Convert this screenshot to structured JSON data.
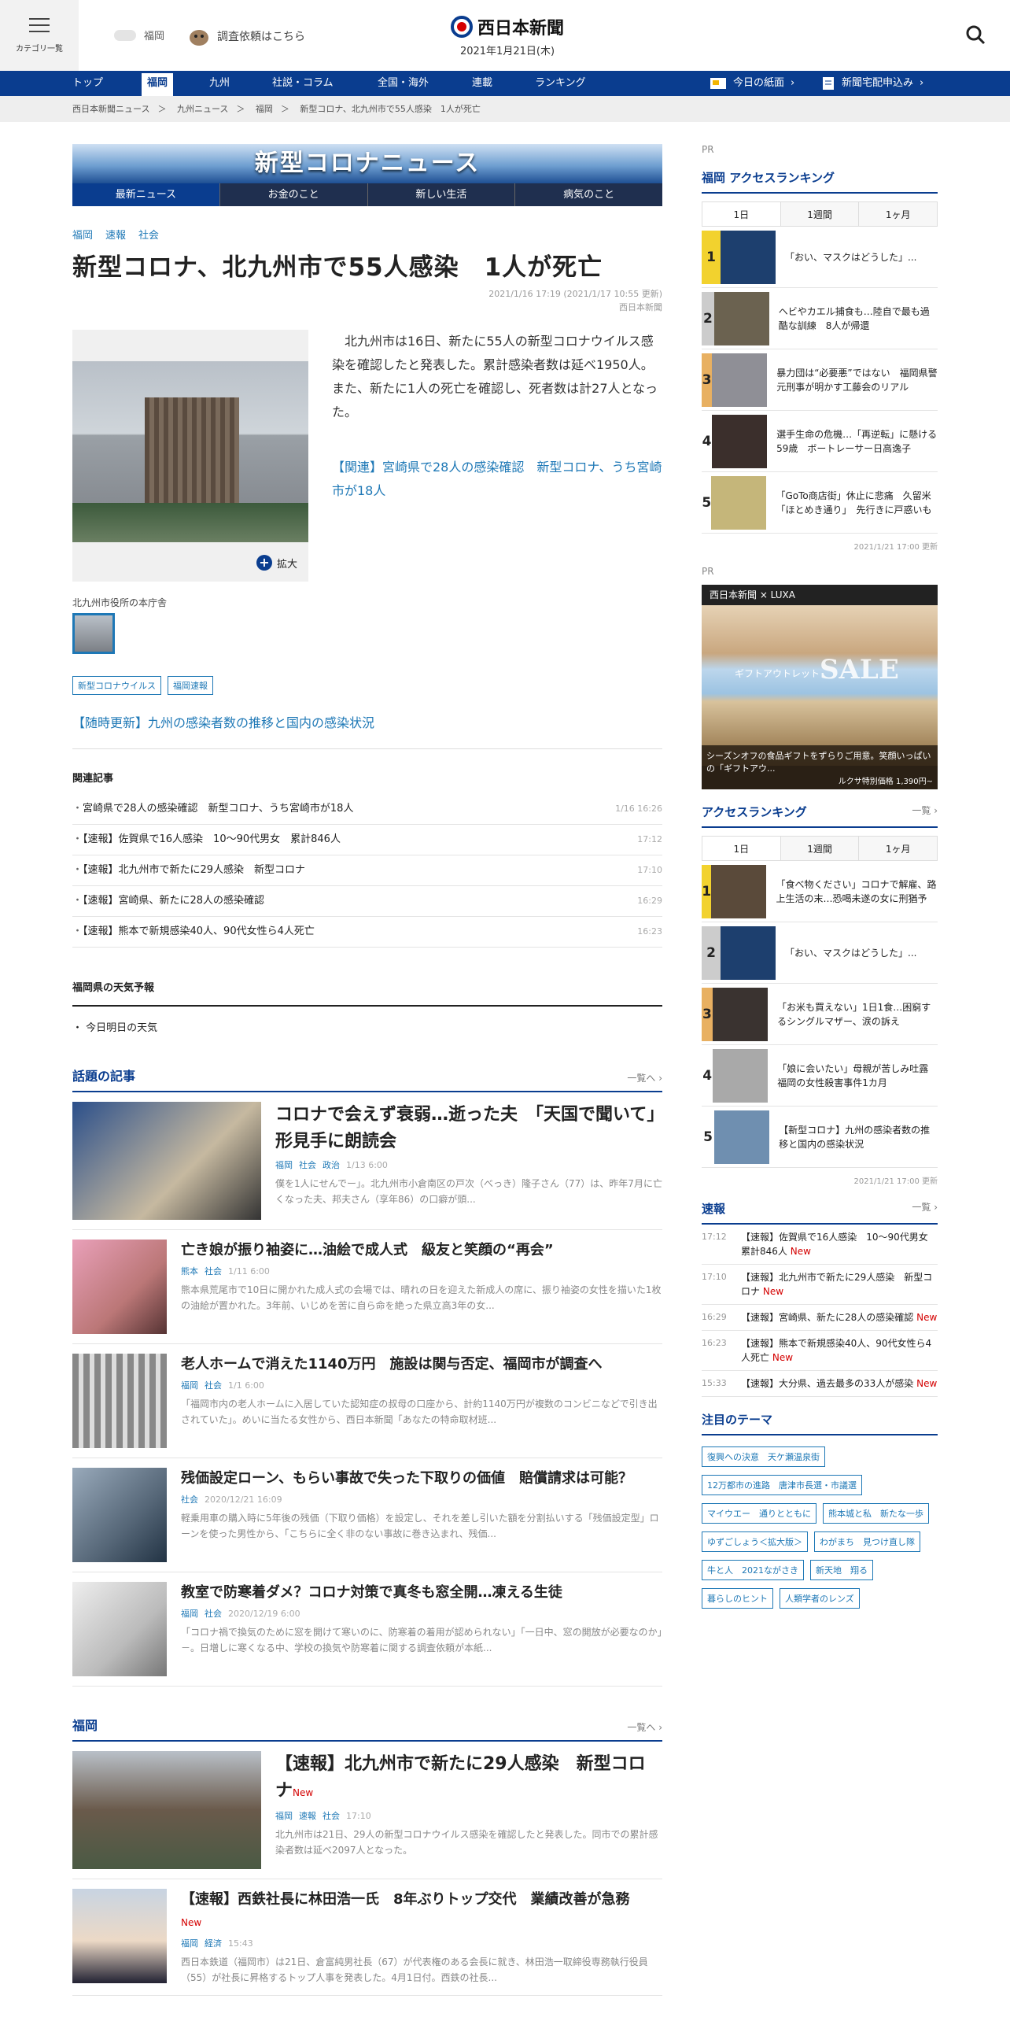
{
  "header": {
    "menu_label": "カテゴリ一覧",
    "weather_area": "福岡",
    "request_link": "調査依頼はこちら",
    "logo_text": "西日本新聞",
    "date": "2021年1月21日(木)"
  },
  "nav": {
    "items": [
      "トップ",
      "福岡",
      "九州",
      "社説・コラム",
      "全国・海外",
      "連載",
      "ランキング"
    ],
    "active": "福岡",
    "todays_paper": "今日の紙面",
    "subscribe": "新聞宅配申込み"
  },
  "breadcrumb": [
    "西日本新聞ニュース",
    "＞",
    "九州ニュース",
    "＞",
    "福岡",
    "＞",
    "新型コロナ、北九州市で55人感染　1人が死亡"
  ],
  "banner": {
    "title": "新型コロナニュース",
    "tabs": [
      "最新ニュース",
      "お金のこと",
      "新しい生活",
      "病気のこと"
    ]
  },
  "article": {
    "categories": [
      "福岡",
      "速報",
      "社会"
    ],
    "title": "新型コロナ、北九州市で55人感染　1人が死亡",
    "timestamp": "2021/1/16 17:19 (2021/1/17 10:55 更新)",
    "source": "西日本新聞",
    "lead": "北九州市は16日、新たに55人の新型コロナウイルス感染を確認したと発表した。累計感染者数は延べ1950人。また、新たに1人の死亡を確認し、死者数は計27人となった。",
    "related_link": "【関連】宮崎県で28人の感染確認　新型コロナ、うち宮崎市が18人",
    "zoom_label": "拡大",
    "photo_caption": "北九州市役所の本庁舎",
    "tags": [
      "新型コロナウイルス",
      "福岡速報"
    ],
    "live_link": "【随時更新】九州の感染者数の推移と国内の感染状況"
  },
  "related": {
    "heading": "関連記事",
    "items": [
      {
        "title": "宮崎県で28人の感染確認　新型コロナ、うち宮崎市が18人",
        "time": "1/16 16:26"
      },
      {
        "title": "【速報】佐賀県で16人感染　10～90代男女　累計846人",
        "time": "17:12"
      },
      {
        "title": "【速報】北九州市で新たに29人感染　新型コロナ",
        "time": "17:10"
      },
      {
        "title": "【速報】宮崎県、新たに28人の感染確認",
        "time": "16:29"
      },
      {
        "title": "【速報】熊本で新規感染40人、90代女性ら4人死亡",
        "time": "16:23"
      }
    ]
  },
  "weather": {
    "heading": "福岡県の天気予報",
    "link": "今日明日の天気"
  },
  "topics": {
    "heading": "話題の記事",
    "more": "一覧へ",
    "items": [
      {
        "title": "コロナで会えず衰弱…逝った夫　「天国で聞いて」形見手に朗読会",
        "cats": [
          "福岡",
          "社会",
          "政治"
        ],
        "date": "1/13 6:00",
        "excerpt": "僕を1人にせんでー」。北九州市小倉南区の戸次（べっき）隆子さん（77）は、昨年7月に亡くなった夫、邦夫さん（享年86）の口癖が頭..."
      },
      {
        "title": "亡き娘が振り袖姿に…油絵で成人式　級友と笑顔の“再会”",
        "cats": [
          "熊本",
          "社会"
        ],
        "date": "1/11 6:00",
        "excerpt": "熊本県荒尾市で10日に開かれた成人式の会場では、晴れの日を迎えた新成人の席に、振り袖姿の女性を描いた1枚の油絵が置かれた。3年前、いじめを苦に自ら命を絶った県立高3年の女..."
      },
      {
        "title": "老人ホームで消えた1140万円　施設は関与否定、福岡市が調査へ",
        "cats": [
          "福岡",
          "社会"
        ],
        "date": "1/1 6:00",
        "excerpt": "「福岡市内の老人ホームに入居していた認知症の叔母の口座から、計約1140万円が複数のコンビニなどで引き出されていた」。めいに当たる女性から、西日本新聞「あなたの特命取材班..."
      },
      {
        "title": "残価設定ローン、もらい事故で失った下取りの価値　賠償請求は可能？",
        "cats": [
          "社会"
        ],
        "date": "2020/12/21 16:09",
        "excerpt": "軽乗用車の購入時に5年後の残価（下取り価格）を設定し、それを差し引いた額を分割払いする「残価設定型」ローンを使った男性から、「こちらに全く非のない事故に巻き込まれ、残価..."
      },
      {
        "title": "教室で防寒着ダメ？コロナ対策で真冬も窓全開…凍える生徒",
        "cats": [
          "福岡",
          "社会"
        ],
        "date": "2020/12/19 6:00",
        "excerpt": "「コロナ禍で換気のために窓を開けて寒いのに、防寒着の着用が認められない」「一日中、窓の開放が必要なのか」－。日増しに寒くなる中、学校の換気や防寒着に関する調査依頼が本紙..."
      }
    ]
  },
  "fukuoka": {
    "heading": "福岡",
    "more": "一覧へ",
    "items": [
      {
        "title": "【速報】北九州市で新たに29人感染　新型コロナ",
        "new": "New",
        "cats": [
          "福岡",
          "速報",
          "社会"
        ],
        "date": "17:10",
        "excerpt": "北九州市は21日、29人の新型コロナウイルス感染を確認したと発表した。同市での累計感染者数は延べ2097人となった。"
      },
      {
        "title": "【速報】西鉄社長に林田浩一氏　8年ぶりトップ交代　業績改善が急務",
        "new": "New",
        "cats": [
          "福岡",
          "経済"
        ],
        "date": "15:43",
        "excerpt": "西日本鉄道（福岡市）は21日、倉富純男社長（67）が代表権のある会長に就き、林田浩一取締役専務執行役員（55）が社長に昇格するトップ人事を発表した。4月1日付。西鉄の社長..."
      }
    ]
  },
  "sidebar": {
    "pr": "PR",
    "ranking1": {
      "heading": "福岡 アクセスランキング",
      "tabs": [
        "1日",
        "1週間",
        "1ヶ月"
      ],
      "items": [
        {
          "rank": "1",
          "title": "「おい、マスクはどうした」..."
        },
        {
          "rank": "2",
          "title": "ヘビやカエル捕食も…陸自で最も過酷な訓練　8人が帰還"
        },
        {
          "rank": "3",
          "title": "暴力団は“必要悪”ではない　福岡県警元刑事が明かす工藤会のリアル"
        },
        {
          "rank": "4",
          "title": "選手生命の危機…「再逆転」に懸ける59歳　ボートレーサー日高逸子"
        },
        {
          "rank": "5",
          "title": "「GoTo商店街」休止に悲痛　久留米「ほとめき通り」　先行きに戸惑いも"
        }
      ],
      "updated": "2021/1/21 17:00 更新"
    },
    "ad": {
      "brand": "西日本新聞 × LUXA",
      "outlet": "ギフトアウトレット",
      "sale": "SALE",
      "text": "シーズンオフの食品ギフトをずらりご用意。笑顔いっぱいの「ギフトアウ...",
      "price_label": "ルクサ特別価格",
      "price": "1,390円~"
    },
    "ranking2": {
      "heading": "アクセスランキング",
      "more": "一覧",
      "tabs": [
        "1日",
        "1週間",
        "1ヶ月"
      ],
      "items": [
        {
          "rank": "1",
          "title": "「食べ物ください」コロナで解雇、路上生活の末…恐喝未遂の女に刑猶予"
        },
        {
          "rank": "2",
          "title": "「おい、マスクはどうした」..."
        },
        {
          "rank": "3",
          "title": "「お米も買えない」1日1食…困窮するシングルマザー、涙の訴え"
        },
        {
          "rank": "4",
          "title": "「娘に会いたい」母親が苦しみ吐露　福岡の女性殺害事件1カ月"
        },
        {
          "rank": "5",
          "title": "【新型コロナ】九州の感染者数の推移と国内の感染状況"
        }
      ],
      "updated": "2021/1/21 17:00 更新"
    },
    "breaking": {
      "heading": "速報",
      "more": "一覧",
      "items": [
        {
          "time": "17:12",
          "title": "【速報】佐賀県で16人感染　10～90代男女　累計846人",
          "new": "New"
        },
        {
          "time": "17:10",
          "title": "【速報】北九州市で新たに29人感染　新型コロナ",
          "new": "New"
        },
        {
          "time": "16:29",
          "title": "【速報】宮崎県、新たに28人の感染確認",
          "new": "New"
        },
        {
          "time": "16:23",
          "title": "【速報】熊本で新規感染40人、90代女性ら4人死亡",
          "new": "New"
        },
        {
          "time": "15:33",
          "title": "【速報】大分県、過去最多の33人が感染",
          "new": "New"
        }
      ]
    },
    "themes": {
      "heading": "注目のテーマ",
      "items": [
        "復興への決意　天ケ瀬温泉街",
        "12万都市の進路　唐津市長選・市議選",
        "マイウエー　通りとともに",
        "熊本城と私　新たな一歩",
        "ゆずごしょう＜拡大版＞",
        "わがまち　見つけ直し隊",
        "牛と人　2021ながさき",
        "新天地　翔る",
        "暮らしのヒント",
        "人類学者のレンズ"
      ]
    }
  }
}
